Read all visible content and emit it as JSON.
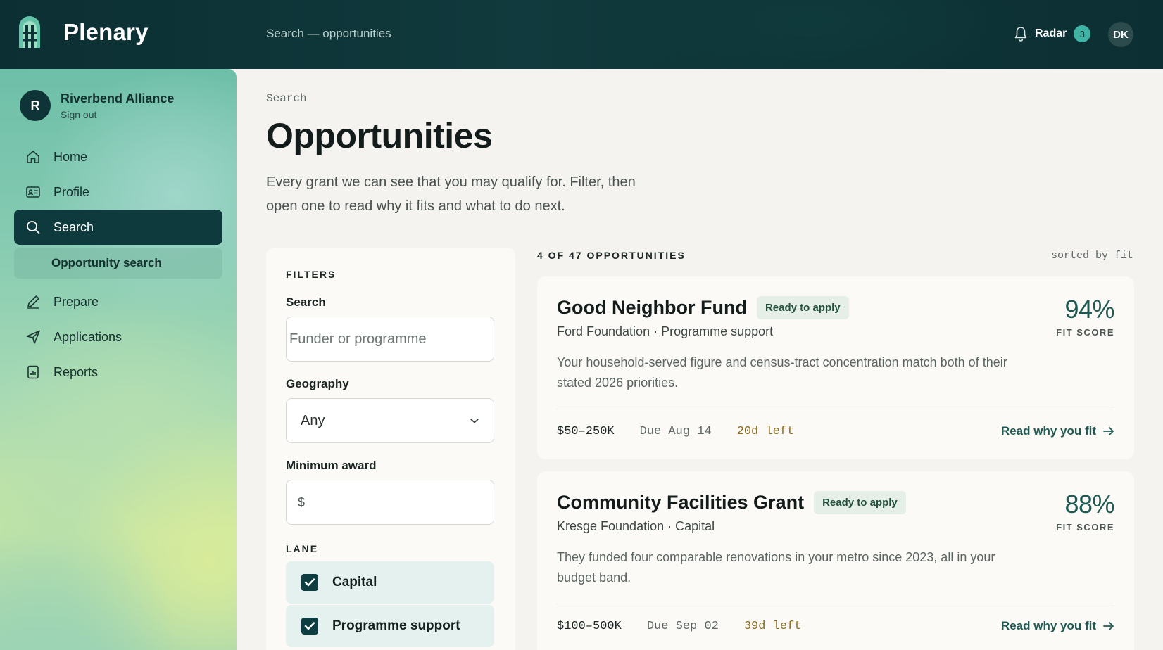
{
  "app": {
    "name": "Plenary",
    "breadcrumb": "Search — opportunities",
    "radar_label": "Radar",
    "radar_count": "3",
    "user_initials": "DK"
  },
  "sidebar": {
    "org_initial": "R",
    "org_name": "Riverbend Alliance",
    "sign_out": "Sign out",
    "items": [
      {
        "label": "Home",
        "icon": "home-icon"
      },
      {
        "label": "Profile",
        "icon": "id-card-icon"
      },
      {
        "label": "Search",
        "icon": "search-icon",
        "active": true
      },
      {
        "label": "Opportunity search",
        "sub": true
      },
      {
        "label": "Prepare",
        "icon": "pencil-icon"
      },
      {
        "label": "Applications",
        "icon": "send-icon"
      },
      {
        "label": "Reports",
        "icon": "report-icon"
      }
    ]
  },
  "page": {
    "crumb": "Search",
    "title": "Opportunities",
    "subtitle": "Every grant we can see that you may qualify for. Filter, then open one to read why it fits and what to do next."
  },
  "filters": {
    "title": "FILTERS",
    "search_label": "Search",
    "search_placeholder": "Funder or programme",
    "geography_label": "Geography",
    "geography_value": "Any",
    "min_award_label": "Minimum award",
    "min_award_prefix": "$",
    "lane_title": "LANE",
    "lanes": [
      {
        "label": "Capital",
        "checked": true
      },
      {
        "label": "Programme support",
        "checked": true
      }
    ]
  },
  "results": {
    "count_label": "4 OF 47 OPPORTUNITIES",
    "sorted_label": "sorted by fit",
    "cards": [
      {
        "title": "Good Neighbor Fund",
        "badge": "Ready to apply",
        "org": "Ford Foundation · Programme support",
        "desc": "Your household-served figure and census-tract concentration match both of their stated 2026 priorities.",
        "fit": "94%",
        "fit_label": "FIT SCORE",
        "amount": "$50–250K",
        "due": "Due Aug 14",
        "left": "20d left",
        "link": "Read why you fit"
      },
      {
        "title": "Community Facilities Grant",
        "badge": "Ready to apply",
        "org": "Kresge Foundation · Capital",
        "desc": "They funded four comparable renovations in your metro since 2023, all in your budget band.",
        "fit": "88%",
        "fit_label": "FIT SCORE",
        "amount": "$100–500K",
        "due": "Due Sep 02",
        "left": "39d left",
        "link": "Read why you fit"
      }
    ]
  }
}
